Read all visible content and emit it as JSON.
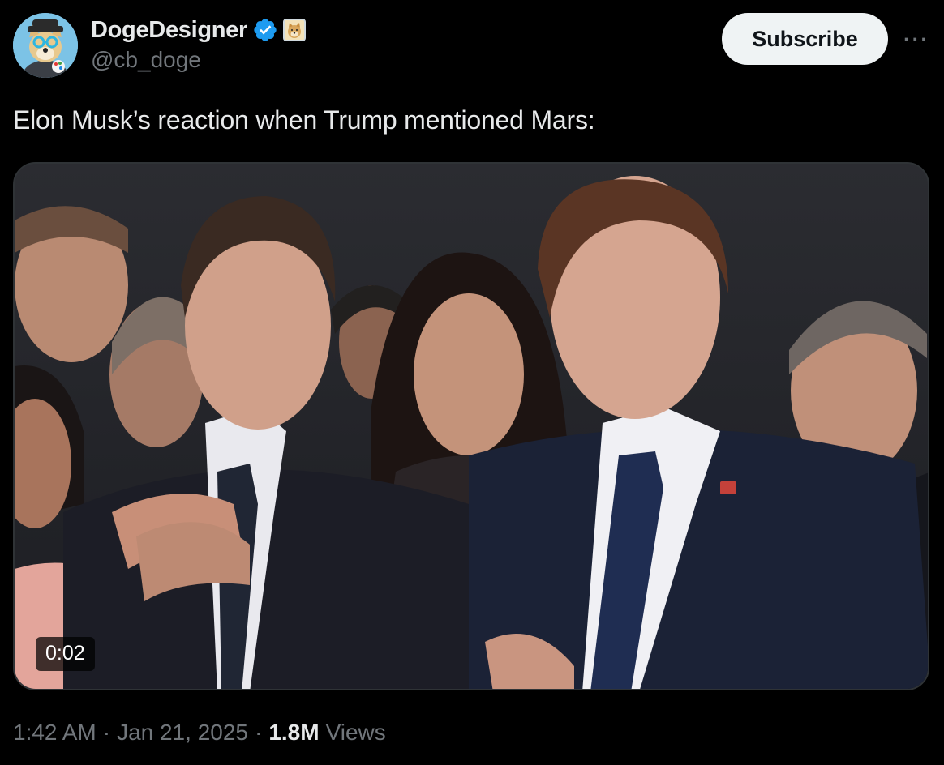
{
  "author": {
    "display_name": "DogeDesigner",
    "handle": "@cb_doge",
    "avatar_icon": "doge-avatar-icon",
    "verified_icon": "verified-badge-icon",
    "affiliate_icon": "doge-affiliate-badge-icon"
  },
  "actions": {
    "subscribe_label": "Subscribe",
    "more_label": "···"
  },
  "tweet": {
    "text": "Elon Musk’s reaction when Trump mentioned Mars:"
  },
  "media": {
    "type": "video",
    "duration": "0:02"
  },
  "meta": {
    "time": "1:42 AM",
    "sep1": "·",
    "date": "Jan 21, 2025",
    "sep2": "·",
    "views_count": "1.8M",
    "views_label": "Views"
  },
  "colors": {
    "background": "#000000",
    "text": "#e7e9ea",
    "muted": "#71767b",
    "verified": "#1d9bf0",
    "button_bg": "#eff3f4"
  }
}
